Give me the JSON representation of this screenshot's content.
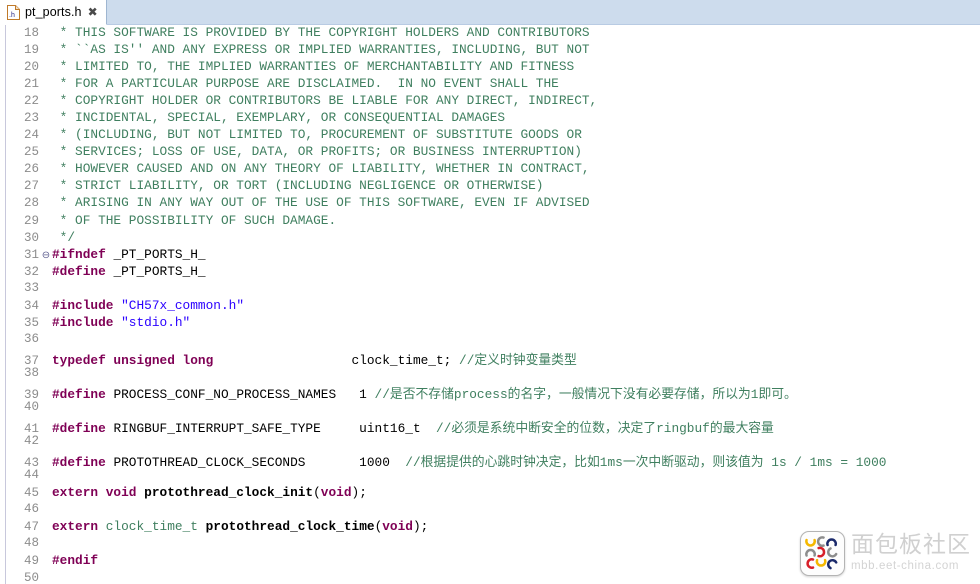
{
  "tab": {
    "title": "pt_ports.h",
    "icon": "h-file-icon",
    "close_label": "✖"
  },
  "editor": {
    "fold_marker": "⊖",
    "first_line": 18,
    "last_line": 50,
    "colors": {
      "comment": "#3f7f5f",
      "preprocessor": "#7f0055",
      "keyword": "#7f0055",
      "string": "#2a00ff",
      "type": "#3f7f5f",
      "background": "#ffffff",
      "line_number": "#8c8c8c",
      "tab_bar": "#cddced"
    },
    "lines": [
      {
        "n": 18,
        "fold": false,
        "tokens": [
          {
            "t": "cmt",
            "s": " * THIS SOFTWARE IS PROVIDED BY THE COPYRIGHT HOLDERS AND CONTRIBUTORS"
          }
        ]
      },
      {
        "n": 19,
        "fold": false,
        "tokens": [
          {
            "t": "cmt",
            "s": " * ``AS IS'' AND ANY EXPRESS OR IMPLIED WARRANTIES, INCLUDING, BUT NOT"
          }
        ]
      },
      {
        "n": 20,
        "fold": false,
        "tokens": [
          {
            "t": "cmt",
            "s": " * LIMITED TO, THE IMPLIED WARRANTIES OF MERCHANTABILITY AND FITNESS"
          }
        ]
      },
      {
        "n": 21,
        "fold": false,
        "tokens": [
          {
            "t": "cmt",
            "s": " * FOR A PARTICULAR PURPOSE ARE DISCLAIMED.  IN NO EVENT SHALL THE"
          }
        ]
      },
      {
        "n": 22,
        "fold": false,
        "tokens": [
          {
            "t": "cmt",
            "s": " * COPYRIGHT HOLDER OR CONTRIBUTORS BE LIABLE FOR ANY DIRECT, INDIRECT,"
          }
        ]
      },
      {
        "n": 23,
        "fold": false,
        "tokens": [
          {
            "t": "cmt",
            "s": " * INCIDENTAL, SPECIAL, EXEMPLARY, OR CONSEQUENTIAL DAMAGES"
          }
        ]
      },
      {
        "n": 24,
        "fold": false,
        "tokens": [
          {
            "t": "cmt",
            "s": " * (INCLUDING, BUT NOT LIMITED TO, PROCUREMENT OF SUBSTITUTE GOODS OR"
          }
        ]
      },
      {
        "n": 25,
        "fold": false,
        "tokens": [
          {
            "t": "cmt",
            "s": " * SERVICES; LOSS OF USE, DATA, OR PROFITS; OR BUSINESS INTERRUPTION)"
          }
        ]
      },
      {
        "n": 26,
        "fold": false,
        "tokens": [
          {
            "t": "cmt",
            "s": " * HOWEVER CAUSED AND ON ANY THEORY OF LIABILITY, WHETHER IN CONTRACT,"
          }
        ]
      },
      {
        "n": 27,
        "fold": false,
        "tokens": [
          {
            "t": "cmt",
            "s": " * STRICT LIABILITY, OR TORT (INCLUDING NEGLIGENCE OR OTHERWISE)"
          }
        ]
      },
      {
        "n": 28,
        "fold": false,
        "tokens": [
          {
            "t": "cmt",
            "s": " * ARISING IN ANY WAY OUT OF THE USE OF THIS SOFTWARE, EVEN IF ADVISED"
          }
        ]
      },
      {
        "n": 29,
        "fold": false,
        "tokens": [
          {
            "t": "cmt",
            "s": " * OF THE POSSIBILITY OF SUCH DAMAGE."
          }
        ]
      },
      {
        "n": 30,
        "fold": false,
        "tokens": [
          {
            "t": "cmt",
            "s": " */"
          }
        ]
      },
      {
        "n": 31,
        "fold": true,
        "tokens": [
          {
            "t": "pre",
            "s": "#ifndef"
          },
          {
            "t": "plain",
            "s": " _PT_PORTS_H_"
          }
        ]
      },
      {
        "n": 32,
        "fold": false,
        "tokens": [
          {
            "t": "pre",
            "s": "#define"
          },
          {
            "t": "plain",
            "s": " _PT_PORTS_H_"
          }
        ]
      },
      {
        "n": 33,
        "fold": false,
        "tokens": []
      },
      {
        "n": 34,
        "fold": false,
        "tokens": [
          {
            "t": "pre",
            "s": "#include"
          },
          {
            "t": "plain",
            "s": " "
          },
          {
            "t": "str",
            "s": "\"CH57x_common.h\""
          }
        ]
      },
      {
        "n": 35,
        "fold": false,
        "tokens": [
          {
            "t": "pre",
            "s": "#include"
          },
          {
            "t": "plain",
            "s": " "
          },
          {
            "t": "str",
            "s": "\"stdio.h\""
          }
        ]
      },
      {
        "n": 36,
        "fold": false,
        "tokens": []
      },
      {
        "n": 37,
        "fold": false,
        "tokens": [
          {
            "t": "kw",
            "s": "typedef unsigned long"
          },
          {
            "t": "plain",
            "s": "                  clock_time_t; "
          },
          {
            "t": "cmt",
            "s": "//定义时钟变量类型"
          }
        ]
      },
      {
        "n": 38,
        "fold": false,
        "tokens": []
      },
      {
        "n": 39,
        "fold": false,
        "tokens": [
          {
            "t": "pre",
            "s": "#define"
          },
          {
            "t": "plain",
            "s": " PROCESS_CONF_NO_PROCESS_NAMES   1 "
          },
          {
            "t": "cmt",
            "s": "//是否不存储process的名字，一般情况下没有必要存储，所以为1即可。"
          }
        ]
      },
      {
        "n": 40,
        "fold": false,
        "tokens": []
      },
      {
        "n": 41,
        "fold": false,
        "tokens": [
          {
            "t": "pre",
            "s": "#define"
          },
          {
            "t": "plain",
            "s": " RINGBUF_INTERRUPT_SAFE_TYPE     uint16_t  "
          },
          {
            "t": "cmt",
            "s": "//必须是系统中断安全的位数，决定了ringbuf的最大容量"
          }
        ]
      },
      {
        "n": 42,
        "fold": false,
        "tokens": []
      },
      {
        "n": 43,
        "fold": false,
        "tokens": [
          {
            "t": "pre",
            "s": "#define"
          },
          {
            "t": "plain",
            "s": " PROTOTHREAD_CLOCK_SECONDS       1000  "
          },
          {
            "t": "cmt",
            "s": "//根据提供的心跳时钟决定，比如1ms一次中断驱动，则该值为 1s / 1ms = 1000"
          }
        ]
      },
      {
        "n": 44,
        "fold": false,
        "tokens": []
      },
      {
        "n": 45,
        "fold": false,
        "tokens": [
          {
            "t": "kw",
            "s": "extern void "
          },
          {
            "t": "fn",
            "s": "protothread_clock_init"
          },
          {
            "t": "plain",
            "s": "("
          },
          {
            "t": "kw",
            "s": "void"
          },
          {
            "t": "plain",
            "s": ");"
          }
        ]
      },
      {
        "n": 46,
        "fold": false,
        "tokens": []
      },
      {
        "n": 47,
        "fold": false,
        "tokens": [
          {
            "t": "kw",
            "s": "extern "
          },
          {
            "t": "type",
            "s": "clock_time_t"
          },
          {
            "t": "plain",
            "s": " "
          },
          {
            "t": "fn",
            "s": "protothread_clock_time"
          },
          {
            "t": "plain",
            "s": "("
          },
          {
            "t": "kw",
            "s": "void"
          },
          {
            "t": "plain",
            "s": ");"
          }
        ]
      },
      {
        "n": 48,
        "fold": false,
        "tokens": []
      },
      {
        "n": 49,
        "fold": false,
        "tokens": [
          {
            "t": "pre",
            "s": "#endif"
          }
        ]
      },
      {
        "n": 50,
        "fold": false,
        "tokens": []
      }
    ]
  },
  "watermark": {
    "name_cn": "面包板社区",
    "url": "mbb.eet-china.com",
    "logo_colors": [
      "#f5b800",
      "#1b2a6b",
      "#d8202a",
      "#8d8d8d"
    ]
  }
}
